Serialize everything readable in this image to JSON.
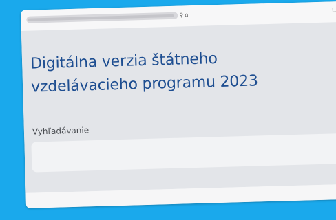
{
  "browser": {
    "zoom_icon": "⚲",
    "home_icon": "⌂",
    "minimize_icon": "_",
    "maximize_icon": "□"
  },
  "main": {
    "title": "Digitálna verzia štátneho vzdelávacieho programu 2023",
    "search": {
      "label": "Vyhľadávanie",
      "value": "",
      "placeholder": ""
    }
  },
  "colors": {
    "background": "#1aa9ec",
    "title": "#1e4e91",
    "content": "#e3e5e9"
  }
}
